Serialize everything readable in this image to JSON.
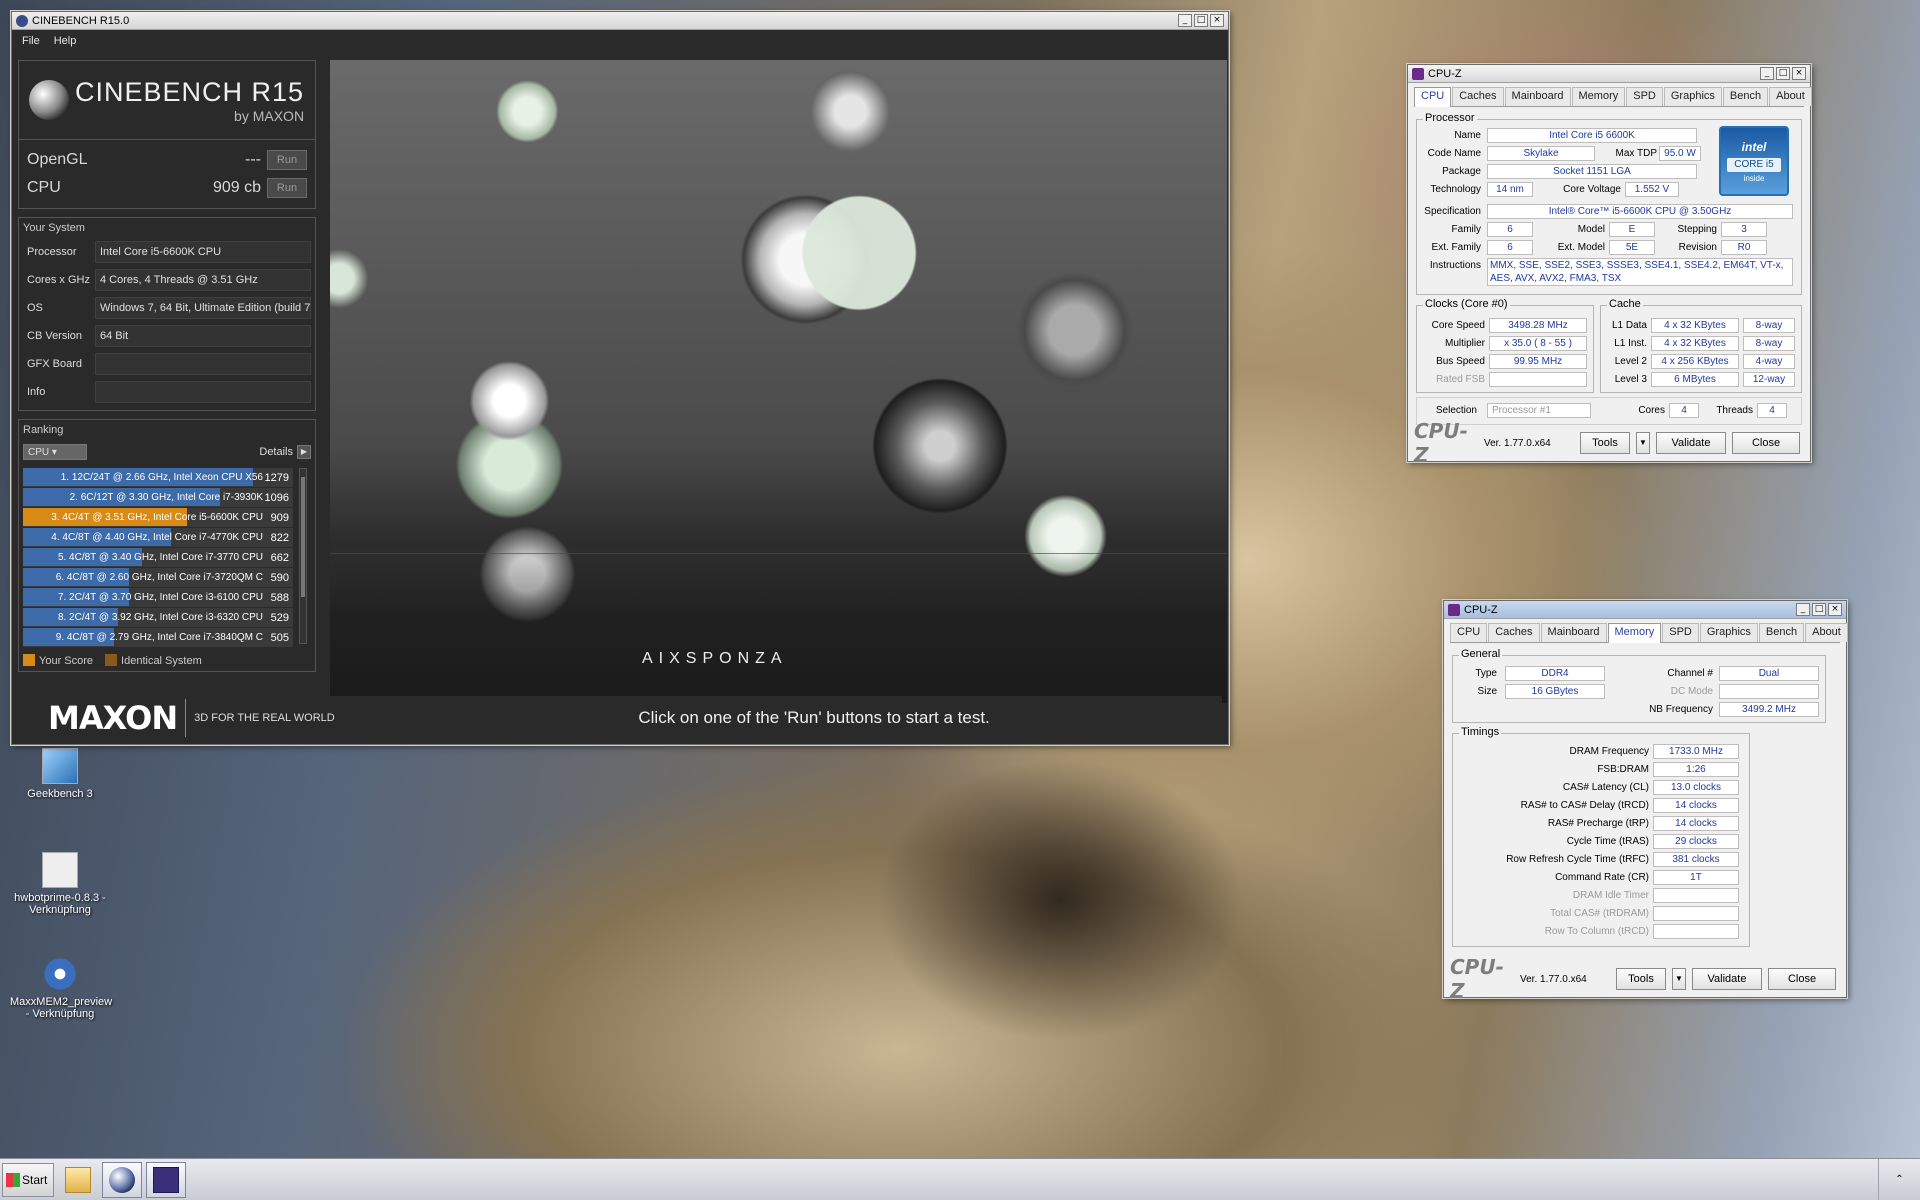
{
  "cinebench": {
    "title": "CINEBENCH R15.0",
    "menu": [
      "File",
      "Help"
    ],
    "logo_main": "CINEBENCH R15",
    "logo_sub": "by MAXON",
    "opengl_label": "OpenGL",
    "opengl_value": "---",
    "cpu_label": "CPU",
    "cpu_value": "909 cb",
    "run_label": "Run",
    "your_system_header": "Your System",
    "system": [
      {
        "key": "Processor",
        "value": "Intel Core i5-6600K CPU"
      },
      {
        "key": "Cores x GHz",
        "value": "4 Cores, 4 Threads @ 3.51 GHz"
      },
      {
        "key": "OS",
        "value": "Windows 7, 64 Bit, Ultimate Edition (build 7"
      },
      {
        "key": "CB Version",
        "value": "64 Bit"
      },
      {
        "key": "GFX Board",
        "value": ""
      },
      {
        "key": "Info",
        "value": ""
      }
    ],
    "ranking_header": "Ranking",
    "ranking_select": "CPU",
    "details_label": "Details",
    "ranking": [
      {
        "label": "1. 12C/24T @ 2.66 GHz, Intel Xeon CPU X56",
        "score": "1279",
        "fraction": 1.0,
        "me": false
      },
      {
        "label": "2. 6C/12T @ 3.30 GHz,  Intel Core i7-3930K",
        "score": "1096",
        "fraction": 0.857,
        "me": false
      },
      {
        "label": "3. 4C/4T @ 3.51 GHz, Intel Core i5-6600K CPU",
        "score": "909",
        "fraction": 0.711,
        "me": true
      },
      {
        "label": "4. 4C/8T @ 4.40 GHz, Intel Core i7-4770K CPU",
        "score": "822",
        "fraction": 0.643,
        "me": false
      },
      {
        "label": "5. 4C/8T @ 3.40 GHz,  Intel Core i7-3770 CPU",
        "score": "662",
        "fraction": 0.518,
        "me": false
      },
      {
        "label": "6. 4C/8T @ 2.60 GHz, Intel Core i7-3720QM C",
        "score": "590",
        "fraction": 0.461,
        "me": false
      },
      {
        "label": "7. 2C/4T @ 3.70 GHz, Intel Core i3-6100 CPU",
        "score": "588",
        "fraction": 0.46,
        "me": false
      },
      {
        "label": "8. 2C/4T @ 3.92 GHz, Intel Core i3-6320 CPU",
        "score": "529",
        "fraction": 0.414,
        "me": false
      },
      {
        "label": "9. 4C/8T @ 2.79 GHz,  Intel Core i7-3840QM C",
        "score": "505",
        "fraction": 0.395,
        "me": false
      }
    ],
    "legend_your_score": "Your Score",
    "legend_identical": "Identical System",
    "colors": {
      "your_score": "#d88a16",
      "identical": "#8a5a1a",
      "bar": "#3d6aa8"
    },
    "footer_brand": "MAXON",
    "footer_tagline": "3D FOR THE REAL WORLD",
    "status_text": "Click on one of the 'Run' buttons to start a test.",
    "render_logo": "AIXSPONZA"
  },
  "cpuz1": {
    "title": "CPU-Z",
    "tabs": [
      "CPU",
      "Caches",
      "Mainboard",
      "Memory",
      "SPD",
      "Graphics",
      "Bench",
      "About"
    ],
    "active_tab": "CPU",
    "processor_group": "Processor",
    "name_label": "Name",
    "name": "Intel Core i5 6600K",
    "code_label": "Code Name",
    "code": "Skylake",
    "tdp_label": "Max TDP",
    "tdp": "95.0 W",
    "package_label": "Package",
    "package": "Socket 1151 LGA",
    "tech_label": "Technology",
    "tech": "14 nm",
    "voltage_label": "Core Voltage",
    "voltage": "1.552 V",
    "spec_label": "Specification",
    "spec": "Intel® Core™ i5-6600K CPU @ 3.50GHz",
    "family_label": "Family",
    "family": "6",
    "model_label": "Model",
    "model": "E",
    "stepping_label": "Stepping",
    "stepping": "3",
    "extfamily_label": "Ext. Family",
    "extfamily": "6",
    "extmodel_label": "Ext. Model",
    "extmodel": "5E",
    "revision_label": "Revision",
    "revision": "R0",
    "instr_label": "Instructions",
    "instr": "MMX, SSE, SSE2, SSE3, SSSE3, SSE4.1, SSE4.2, EM64T, VT-x, AES, AVX, AVX2, FMA3, TSX",
    "clocks_group": "Clocks (Core #0)",
    "corespeed_label": "Core Speed",
    "corespeed": "3498.28 MHz",
    "mult_label": "Multiplier",
    "mult": "x 35.0 ( 8 - 55 )",
    "bus_label": "Bus Speed",
    "bus": "99.95 MHz",
    "fsb_label": "Rated FSB",
    "fsb": "",
    "cache_group": "Cache",
    "l1d_label": "L1 Data",
    "l1d": "4 x 32 KBytes",
    "l1d_way": "8-way",
    "l1i_label": "L1 Inst.",
    "l1i": "4 x 32 KBytes",
    "l1i_way": "8-way",
    "l2_label": "Level 2",
    "l2": "4 x 256 KBytes",
    "l2_way": "4-way",
    "l3_label": "Level 3",
    "l3": "6 MBytes",
    "l3_way": "12-way",
    "selection_label": "Selection",
    "selection": "Processor #1",
    "cores_label": "Cores",
    "cores": "4",
    "threads_label": "Threads",
    "threads": "4",
    "intel_brand": "intel",
    "intel_line": "CORE i5",
    "intel_inside": "inside",
    "logo": "CPU-Z",
    "version": "Ver. 1.77.0.x64",
    "tools": "Tools",
    "validate": "Validate",
    "close": "Close"
  },
  "cpuz2": {
    "title": "CPU-Z",
    "tabs": [
      "CPU",
      "Caches",
      "Mainboard",
      "Memory",
      "SPD",
      "Graphics",
      "Bench",
      "About"
    ],
    "active_tab": "Memory",
    "general_group": "General",
    "type_label": "Type",
    "type": "DDR4",
    "size_label": "Size",
    "size": "16 GBytes",
    "channel_label": "Channel #",
    "channel": "Dual",
    "dcmode_label": "DC Mode",
    "dcmode": "",
    "nbfreq_label": "NB Frequency",
    "nbfreq": "3499.2 MHz",
    "timings_group": "Timings",
    "timings": [
      {
        "label": "DRAM Frequency",
        "value": "1733.0 MHz",
        "dim": false
      },
      {
        "label": "FSB:DRAM",
        "value": "1:26",
        "dim": false
      },
      {
        "label": "CAS# Latency (CL)",
        "value": "13.0 clocks",
        "dim": false
      },
      {
        "label": "RAS# to CAS# Delay (tRCD)",
        "value": "14 clocks",
        "dim": false
      },
      {
        "label": "RAS# Precharge (tRP)",
        "value": "14 clocks",
        "dim": false
      },
      {
        "label": "Cycle Time (tRAS)",
        "value": "29 clocks",
        "dim": false
      },
      {
        "label": "Row Refresh Cycle Time (tRFC)",
        "value": "381 clocks",
        "dim": false
      },
      {
        "label": "Command Rate (CR)",
        "value": "1T",
        "dim": false
      },
      {
        "label": "DRAM Idle Timer",
        "value": "",
        "dim": true
      },
      {
        "label": "Total CAS# (tRDRAM)",
        "value": "",
        "dim": true
      },
      {
        "label": "Row To Column (tRCD)",
        "value": "",
        "dim": true
      }
    ],
    "logo": "CPU-Z",
    "version": "Ver. 1.77.0.x64",
    "tools": "Tools",
    "validate": "Validate",
    "close": "Close"
  },
  "desktop": {
    "icons": [
      {
        "label": "Geekbench 3"
      },
      {
        "label": "hwbotprime-0.8.3 - Verknüpfung"
      },
      {
        "label": "MaxxMEM2_preview - Verknüpfung"
      }
    ]
  },
  "taskbar": {
    "start": "Start"
  }
}
